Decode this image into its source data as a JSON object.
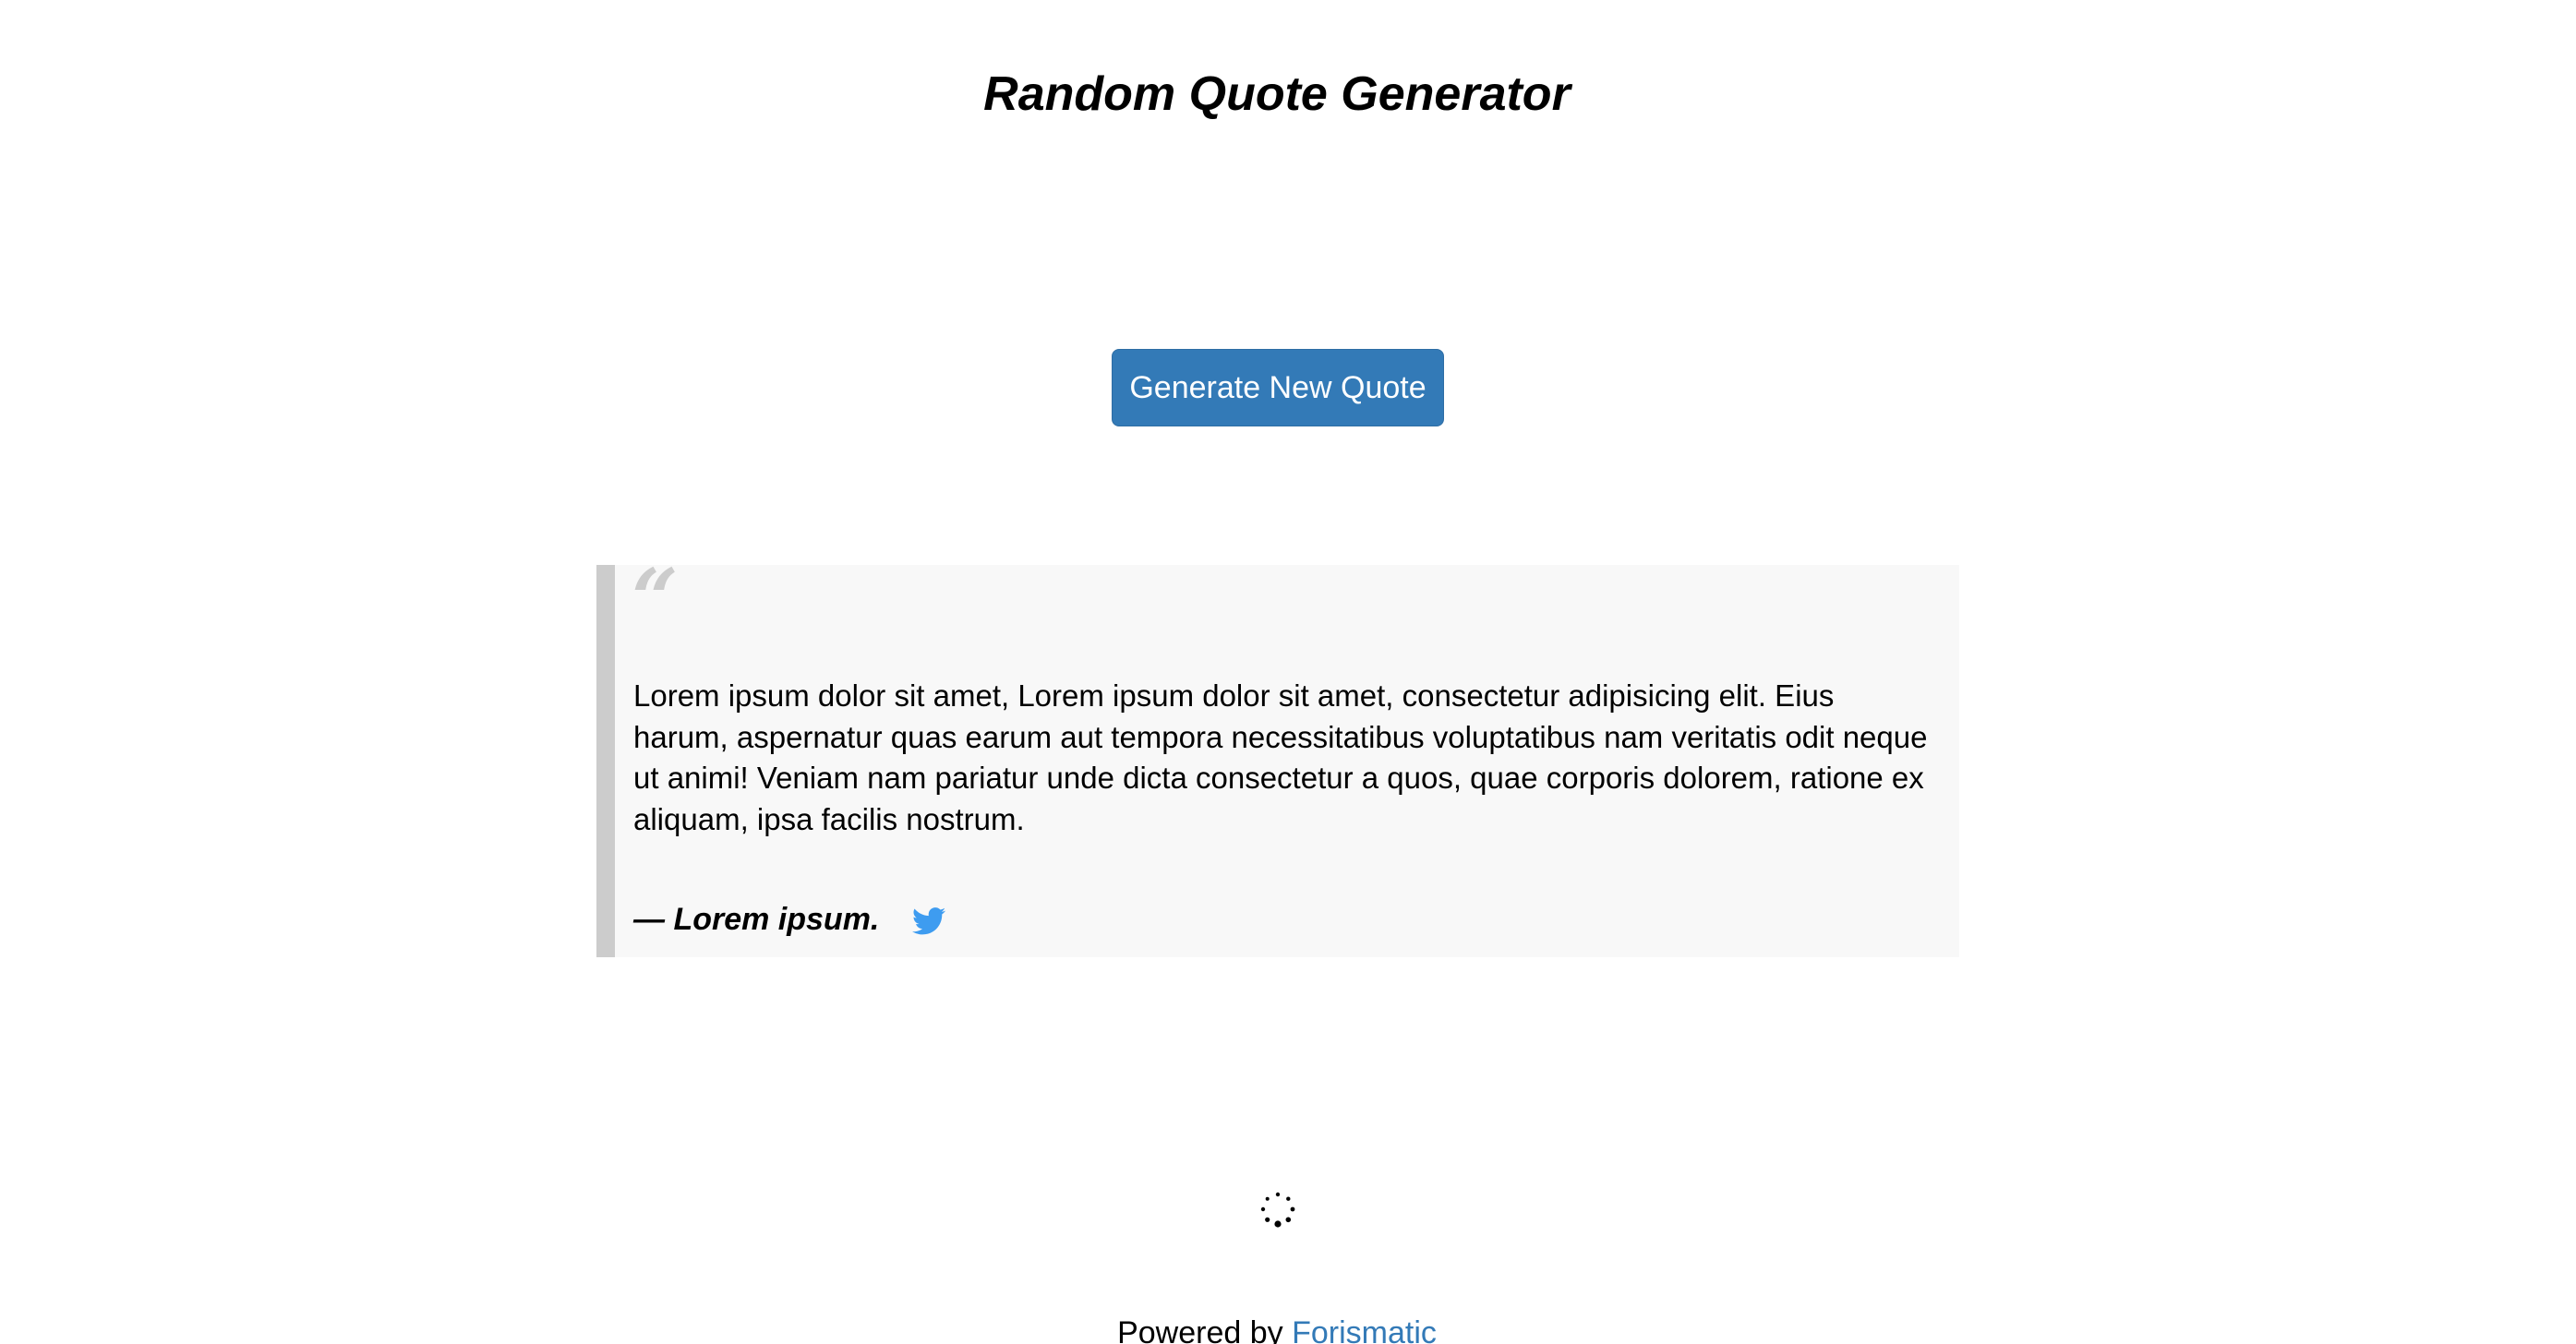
{
  "header": {
    "title": "Random Quote Generator"
  },
  "actions": {
    "generate_label": "Generate New Quote"
  },
  "quote": {
    "open_mark": "“",
    "text": "Lorem ipsum dolor sit amet, Lorem ipsum dolor sit amet, consectetur adipisicing elit. Eius harum, aspernatur quas earum aut tempora necessitatibus voluptatibus nam veritatis odit neque ut animi! Veniam nam pariatur unde dicta consectetur a quos, quae corporis dolorem, ratione ex aliquam, ipsa facilis nostrum.",
    "author": "— Lorem ipsum."
  },
  "share": {
    "icon": "twitter-icon",
    "color": "#3e9cf0"
  },
  "loading": {
    "icon": "loading-spinner-icon"
  },
  "footer": {
    "prefix": "Powered by ",
    "link_label": "Forismatic",
    "link_color": "#337ab7"
  },
  "colors": {
    "button_bg": "#337ab7",
    "quote_bg": "#f8f8f8",
    "quote_border": "#cccccc"
  }
}
